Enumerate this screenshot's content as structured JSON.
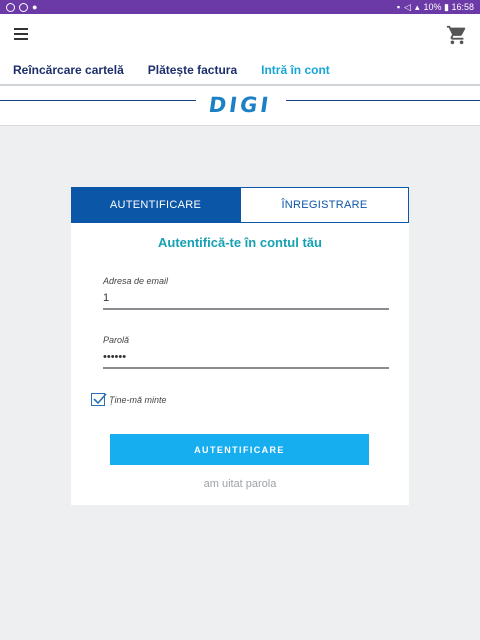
{
  "statusbar": {
    "right_text": "10% ▮ 16:58",
    "color": "#6b3aa6"
  },
  "nav": {
    "items": [
      {
        "label": "Reîncărcare cartelă"
      },
      {
        "label": "Plătește factura"
      },
      {
        "label": "Intră în cont",
        "active": true
      }
    ]
  },
  "logo": {
    "text": "DIGI"
  },
  "tabs": [
    {
      "label": "AUTENTIFICARE",
      "active": true
    },
    {
      "label": "ÎNREGISTRARE",
      "active": false
    }
  ],
  "form": {
    "title": "Autentifică-te în contul tău",
    "email": {
      "label": "Adresa de email",
      "value": "1"
    },
    "password": {
      "label": "Parolă",
      "value": "••••••"
    },
    "remember": {
      "label": "Ține-mă minte",
      "checked": true
    },
    "submit_label": "AUTENTIFICARE",
    "forgot_label": "am uitat parola"
  },
  "colors": {
    "primary": "#0c56a8",
    "accent": "#17aef0",
    "title": "#16a0b3",
    "nav_active": "#16a7d8"
  },
  "icons": [
    "hamburger-icon",
    "cart-icon",
    "checkmark-icon"
  ]
}
